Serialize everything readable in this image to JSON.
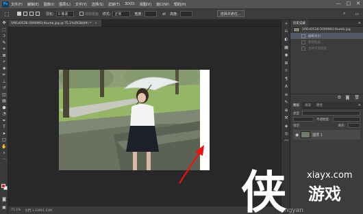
{
  "menubar": {
    "logo": "Ps",
    "items": [
      "文件(F)",
      "编辑(E)",
      "图像(I)",
      "图层(L)",
      "文字(Y)",
      "选择(S)",
      "滤镜(T)",
      "3D(D)",
      "视图(V)",
      "窗口(W)",
      "帮助(H)"
    ],
    "window_controls": [
      "—",
      "□",
      "✕"
    ]
  },
  "options": {
    "feather_label": "羽化:",
    "feather_value": "0 像素",
    "antialias_label": "消除锯齿",
    "style_label": "样式:",
    "style_value": "正常",
    "width_label": "宽度:",
    "height_label": "高度:",
    "select_mask_button": "选择并遮住..."
  },
  "document": {
    "tab_title": "5f9140536-5090993.thumb.jpg @ 75.1%(RGB/8#) *",
    "close": "×"
  },
  "status": {
    "zoom": "75.1%",
    "doc_info": "文档:1.03M/1.03M"
  },
  "history_panel": {
    "tabs": [
      "历史记录"
    ],
    "items": [
      {
        "label": "5f9140536-5090993.thumb.jpg",
        "state": "snapshot"
      },
      {
        "label": "画布大小",
        "state": "active"
      },
      {
        "label": "新建图层",
        "state": "dim"
      },
      {
        "label": "合并可见图层",
        "state": "dim"
      }
    ]
  },
  "layers_panel": {
    "tabs": [
      "图层",
      "通道",
      "路径"
    ],
    "kind_label": "类型",
    "opacity_label": "不透明度:",
    "fill_label": "填充:",
    "lock_label": "锁定:",
    "layer_name": "图层 1"
  },
  "watermark": {
    "glyph": "侠",
    "site": "xiayx.com",
    "brand": "游戏",
    "sub": "jingyan"
  }
}
